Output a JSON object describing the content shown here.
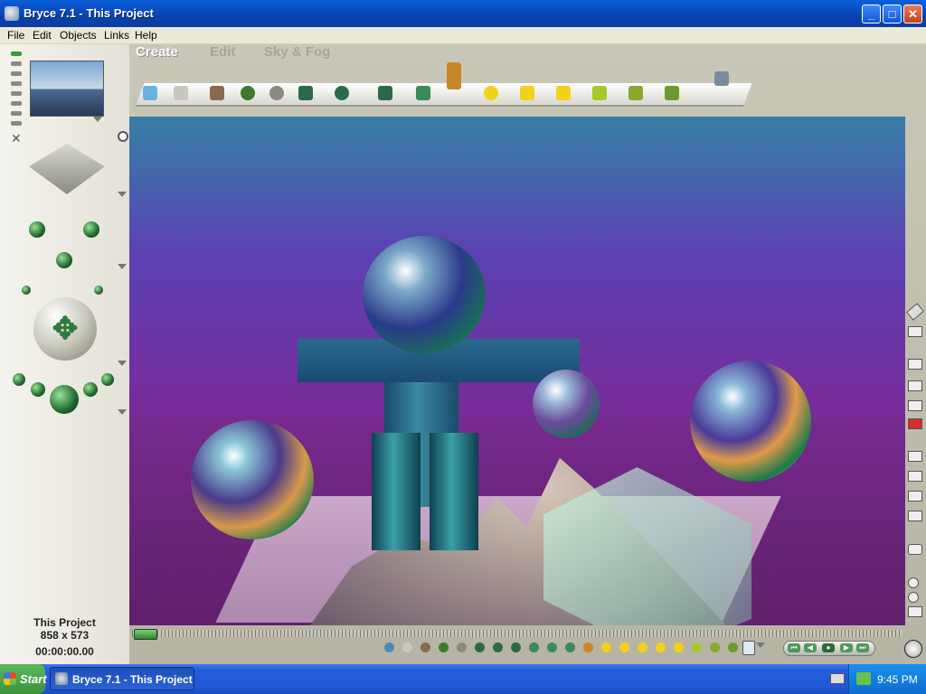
{
  "window": {
    "title": "Bryce 7.1  -  This Project",
    "minimize": "_",
    "maximize": "□",
    "close": "✕"
  },
  "menu": [
    "File",
    "Edit",
    "Objects",
    "Links",
    "Help"
  ],
  "palette_tabs": [
    {
      "label": "Create",
      "active": true
    },
    {
      "label": "Edit",
      "active": false
    },
    {
      "label": "Sky & Fog",
      "active": false
    }
  ],
  "status": {
    "document_name": "This Project",
    "resolution": "858 x 573",
    "timecode": "00:00:00.00"
  },
  "icons": {
    "big_navigator": "move-arrows-icon",
    "globe": "globe-icon",
    "keyboard": "keyboard-icon"
  },
  "taskbar": {
    "start_label": "Start",
    "task_label": "Bryce 7.1  -  This Project",
    "clock": "9:45 PM"
  },
  "colors": {
    "titlebar": "#0a5fd8",
    "taskbar": "#245edb",
    "start_green": "#3a923a"
  }
}
